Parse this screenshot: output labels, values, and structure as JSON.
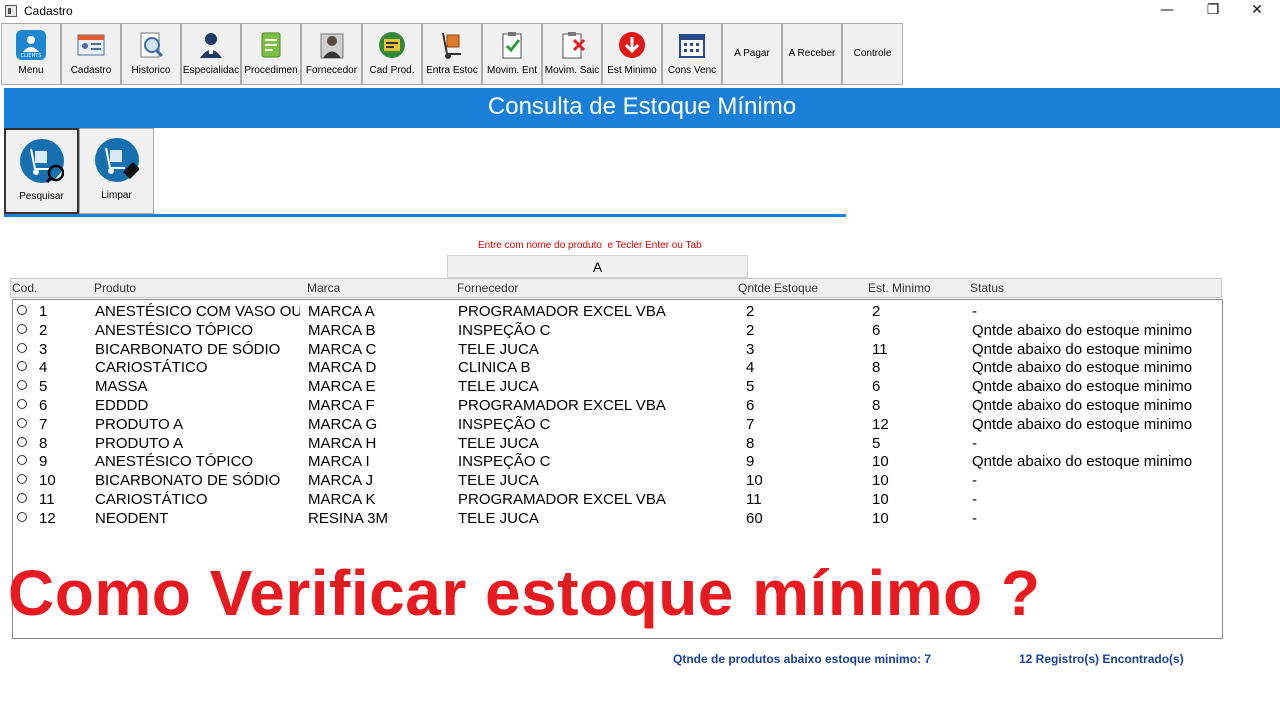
{
  "window": {
    "title": "Cadastro",
    "controls": [
      "—",
      "❐",
      "✕"
    ]
  },
  "toolbar": {
    "buttons": [
      {
        "label": "Menu",
        "icon": "clients-icon"
      },
      {
        "label": "Cadastro",
        "icon": "register-card-icon"
      },
      {
        "label": "Historico",
        "icon": "history-search-icon"
      },
      {
        "label": "Especialidac",
        "icon": "doctor-icon"
      },
      {
        "label": "Procedimen",
        "icon": "document-icon"
      },
      {
        "label": "Fornecedor",
        "icon": "supplier-icon"
      },
      {
        "label": "Cad Prod.",
        "icon": "product-card-icon"
      },
      {
        "label": "Entra Estoc",
        "icon": "hand-truck-icon"
      },
      {
        "label": "Movim. Ent",
        "icon": "clipboard-check-icon"
      },
      {
        "label": "Movim. Saic",
        "icon": "clipboard-x-icon"
      },
      {
        "label": "Est Minimo",
        "icon": "arrow-down-icon"
      },
      {
        "label": "Cons Venc",
        "icon": "calendar-icon"
      },
      {
        "label": "A Pagar",
        "icon": ""
      },
      {
        "label": "A Receber",
        "icon": ""
      },
      {
        "label": "Controle",
        "icon": ""
      }
    ]
  },
  "banner": {
    "title": "Consulta de Estoque Mínimo"
  },
  "actions": {
    "search_label": "Pesquisar",
    "clear_label": "Limpar"
  },
  "search": {
    "hint": "Entre com nome do produto  e Tecler Enter ou Tab",
    "value": "A"
  },
  "table": {
    "columns": [
      "Cod.",
      "Produto",
      "Marca",
      "Fornecedor",
      "Qntde Estoque",
      "Est. Minimo",
      "Status"
    ],
    "rows": [
      [
        "1",
        "ANESTÉSICO COM VASO OU .",
        "MARCA A",
        "PROGRAMADOR EXCEL VBA",
        "2",
        "2",
        "-"
      ],
      [
        "2",
        "ANESTÉSICO TÓPICO",
        "MARCA B",
        "INSPEÇÃO C",
        "2",
        "6",
        "Qntde abaixo do estoque minimo"
      ],
      [
        "3",
        "BICARBONATO DE SÓDIO",
        "MARCA C",
        "TELE JUCA",
        "3",
        "11",
        "Qntde abaixo do estoque minimo"
      ],
      [
        "4",
        "CARIOSTÁTICO",
        "MARCA D",
        "CLINICA B",
        "4",
        "8",
        "Qntde abaixo do estoque minimo"
      ],
      [
        "5",
        "MASSA",
        "MARCA E",
        "TELE JUCA",
        "5",
        "6",
        "Qntde abaixo do estoque minimo"
      ],
      [
        "6",
        "EDDDD",
        "MARCA F",
        "PROGRAMADOR EXCEL VBA",
        "6",
        "8",
        "Qntde abaixo do estoque minimo"
      ],
      [
        "7",
        "PRODUTO A",
        "MARCA G",
        "INSPEÇÃO C",
        "7",
        "12",
        "Qntde abaixo do estoque minimo"
      ],
      [
        "8",
        "PRODUTO A",
        "MARCA H",
        "TELE JUCA",
        "8",
        "5",
        "-"
      ],
      [
        "9",
        "ANESTÉSICO TÓPICO",
        "MARCA I",
        "INSPEÇÃO C",
        "9",
        "10",
        "Qntde abaixo do estoque minimo"
      ],
      [
        "10",
        "BICARBONATO DE SÓDIO",
        "MARCA J",
        "TELE JUCA",
        "10",
        "10",
        "-"
      ],
      [
        "11",
        "CARIOSTÁTICO",
        "MARCA K",
        "PROGRAMADOR EXCEL VBA",
        "11",
        "10",
        "-"
      ],
      [
        "12",
        "NEODENT",
        "RESINA 3M",
        "TELE JUCA",
        "60",
        "10",
        "-"
      ]
    ]
  },
  "overlay": {
    "headline": "Como Verificar estoque mínimo ?"
  },
  "footer": {
    "below_min": "Qtnde de produtos abaixo estoque minimo: 7",
    "records": "12 Registro(s) Encontrado(s)"
  },
  "colors": {
    "banner": "#1a7fd8",
    "headline": "#e8191f",
    "footer_text": "#1a3fa0",
    "hint": "#e00000"
  }
}
